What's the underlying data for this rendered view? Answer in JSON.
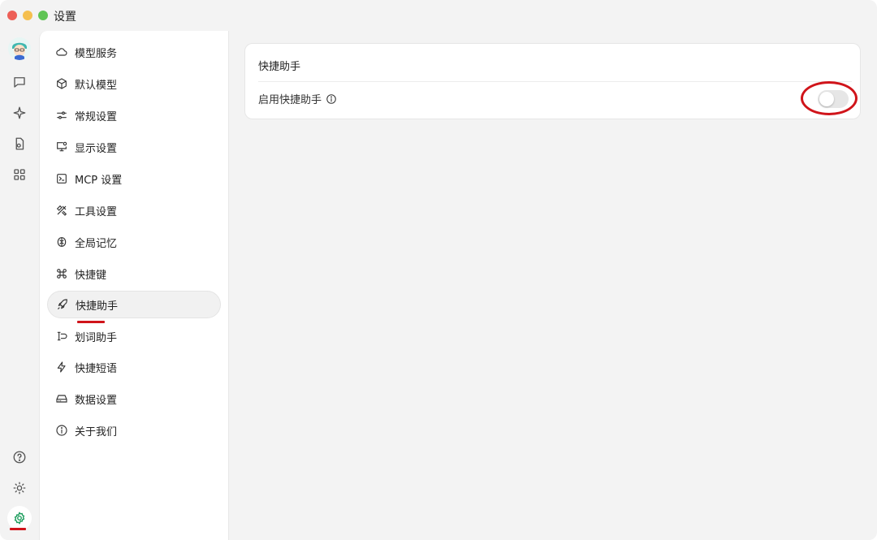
{
  "window": {
    "title": "设置"
  },
  "rail": {
    "items": [
      {
        "icon": "chat-bubble-icon"
      },
      {
        "icon": "sparkle-icon"
      },
      {
        "icon": "document-icon"
      },
      {
        "icon": "grid-icon"
      }
    ],
    "bottom": [
      {
        "icon": "help-icon"
      },
      {
        "icon": "sun-icon"
      },
      {
        "icon": "gear-icon",
        "active": true
      }
    ]
  },
  "menu": {
    "items": [
      {
        "label": "模型服务",
        "icon": "cloud-icon"
      },
      {
        "label": "默认模型",
        "icon": "cube-icon"
      },
      {
        "label": "常规设置",
        "icon": "sliders-icon"
      },
      {
        "label": "显示设置",
        "icon": "monitor-icon"
      },
      {
        "label": "MCP 设置",
        "icon": "terminal-icon"
      },
      {
        "label": "工具设置",
        "icon": "tools-icon"
      },
      {
        "label": "全局记忆",
        "icon": "brain-icon"
      },
      {
        "label": "快捷键",
        "icon": "command-icon"
      },
      {
        "label": "快捷助手",
        "icon": "rocket-icon",
        "active": true
      },
      {
        "label": "划词助手",
        "icon": "text-cursor-icon"
      },
      {
        "label": "快捷短语",
        "icon": "zap-icon"
      },
      {
        "label": "数据设置",
        "icon": "hard-drive-icon"
      },
      {
        "label": "关于我们",
        "icon": "info-icon"
      }
    ]
  },
  "main": {
    "card": {
      "title": "快捷助手",
      "rows": [
        {
          "label": "启用快捷助手",
          "info_icon": "info-icon",
          "toggle": false
        }
      ]
    }
  },
  "colors": {
    "annotation_red": "#d0141a",
    "active_gear": "#1a9c5b"
  }
}
